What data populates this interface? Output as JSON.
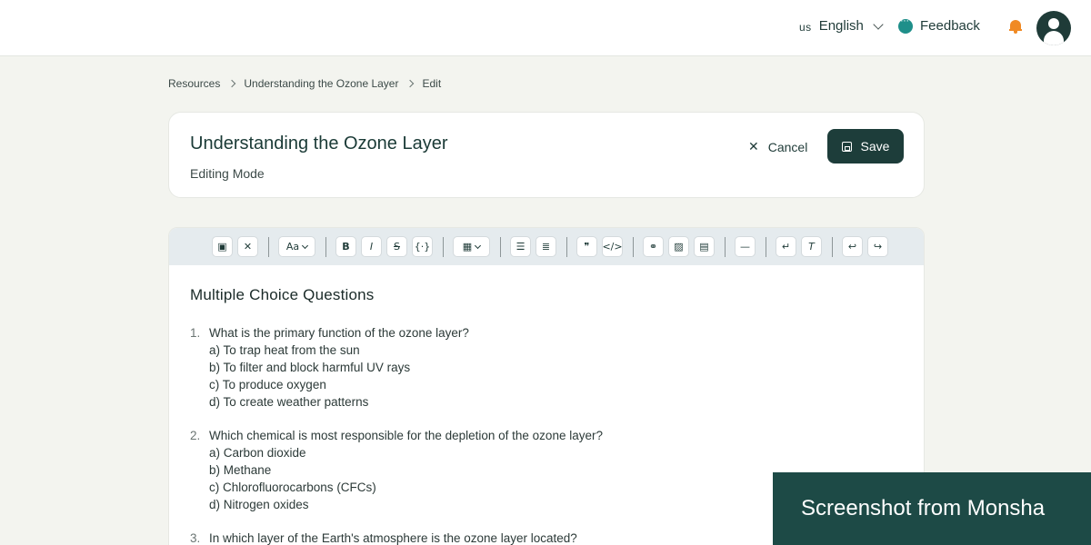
{
  "topbar": {
    "language_code": "us",
    "language_label": "English",
    "feedback_label": "Feedback"
  },
  "breadcrumb": {
    "items": [
      "Resources",
      "Understanding the Ozone Layer",
      "Edit"
    ]
  },
  "header": {
    "title": "Understanding the Ozone Layer",
    "subtitle": "Editing Mode",
    "cancel_label": "Cancel",
    "save_label": "Save"
  },
  "toolbar": {
    "font_label": "Aa",
    "buttons": [
      "save-icon",
      "close-icon",
      "font-dropdown",
      "bold-icon",
      "italic-icon",
      "strikethrough-icon",
      "variable-icon",
      "table-dropdown",
      "bullet-list-icon",
      "numbered-list-icon",
      "quote-icon",
      "code-icon",
      "link-icon",
      "image-icon",
      "calculator-icon",
      "horizontal-rule-icon",
      "wrap-icon",
      "clear-format-icon",
      "undo-icon",
      "redo-icon"
    ]
  },
  "content": {
    "heading": "Multiple Choice Questions",
    "questions": [
      {
        "num": "1.",
        "text": "What is the primary function of the ozone layer?",
        "answers": [
          "a) To trap heat from the sun",
          "b) To filter and block harmful UV rays",
          "c) To produce oxygen",
          "d) To create weather patterns"
        ]
      },
      {
        "num": "2.",
        "text": "Which chemical is most responsible for the depletion of the ozone layer?",
        "answers": [
          "a) Carbon dioxide",
          "b) Methane",
          "c) Chlorofluorocarbons (CFCs)",
          "d) Nitrogen oxides"
        ]
      },
      {
        "num": "3.",
        "text": "In which layer of the Earth's atmosphere is the ozone layer located?",
        "answers": []
      }
    ]
  },
  "watermark": "Screenshot from Monsha",
  "colors": {
    "primary": "#1d3d3a",
    "accent_bell": "#f08a24",
    "feedback_icon": "#1f8f8a",
    "background": "#f3f4ef",
    "toolbar_bg": "#e5ebee"
  }
}
